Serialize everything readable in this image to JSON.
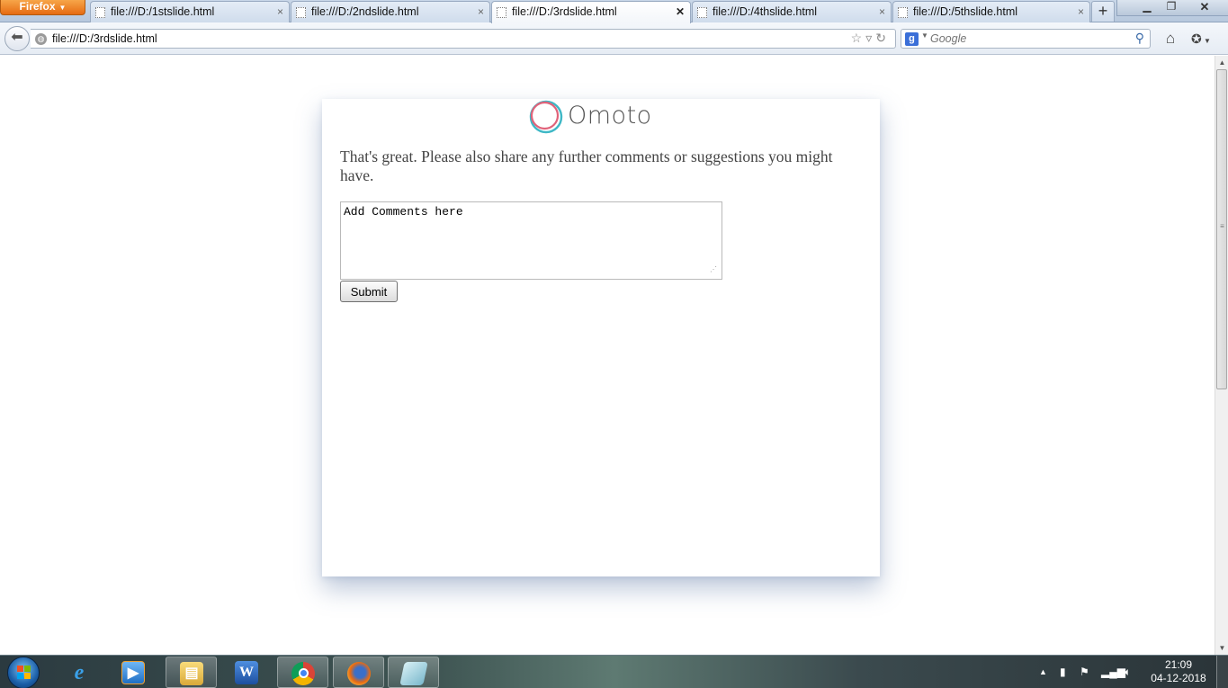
{
  "browser": {
    "menu_button": "Firefox",
    "tabs": [
      {
        "title": "file:///D:/1stslide.html"
      },
      {
        "title": "file:///D:/2ndslide.html"
      },
      {
        "title": "file:///D:/3rdslide.html"
      },
      {
        "title": "file:///D:/4thslide.html"
      },
      {
        "title": "file:///D:/5thslide.html"
      }
    ],
    "active_tab_index": 2,
    "url": "file:///D:/3rdslide.html",
    "search_engine_letter": "g",
    "search_placeholder": "Google"
  },
  "page": {
    "logo_text": "Omoto",
    "prompt": "That's great. Please also share any further comments or suggestions you might have.",
    "comments_placeholder": "Add Comments here",
    "submit_label": "Submit"
  },
  "taskbar": {
    "apps": [
      "internet-explorer-icon",
      "media-player-icon",
      "file-explorer-icon",
      "word-icon",
      "chrome-icon",
      "firefox-icon",
      "document-app-icon"
    ],
    "clock_time": "21:09",
    "clock_date": "04-12-2018"
  },
  "colors": {
    "logo_ring_red": "#e0637a",
    "logo_ring_teal": "#3fb8c6",
    "firefox_orange": "#e66b12"
  }
}
